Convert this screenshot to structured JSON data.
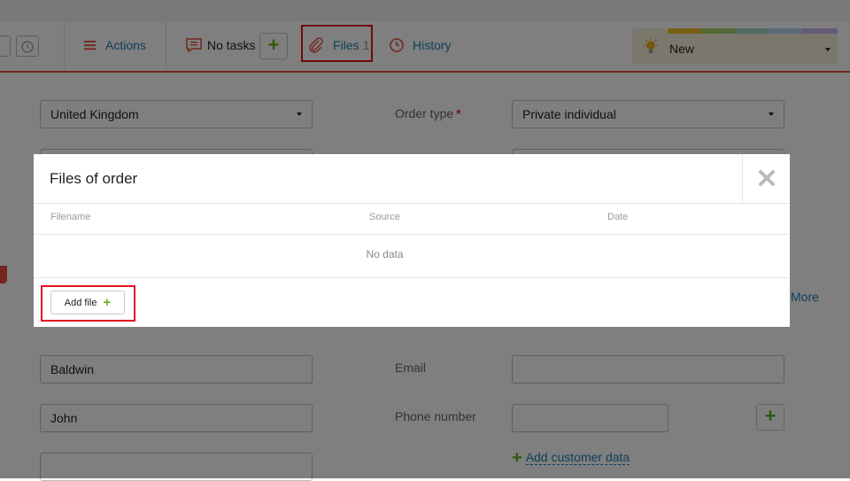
{
  "toolbar": {
    "actions_label": "Actions",
    "tasks_label": "No tasks",
    "files_label": "Files",
    "files_count": "1",
    "history_label": "History",
    "add_task_label": "+"
  },
  "status": {
    "selected": "New",
    "strip_colors": [
      "#f5c02e",
      "#a6d36d",
      "#62cfa5",
      "#9fd9e3",
      "#b9d6f0",
      "#c4b4e8",
      "#f0a4c8"
    ]
  },
  "form": {
    "country_value": "United Kingdom",
    "order_type_label": "Order type",
    "order_type_required": "*",
    "order_type_value": "Private individual",
    "last_name_value": "Baldwin",
    "first_name_value": "John",
    "email_label": "Email",
    "phone_label": "Phone number",
    "add_phone_label": "+",
    "add_customer_data": "Add customer data",
    "more_label": "More"
  },
  "modal": {
    "title": "Files of order",
    "columns": [
      "Filename",
      "Source",
      "Date"
    ],
    "empty_text": "No data",
    "add_file_label": "Add file"
  },
  "colors": {
    "accent_red": "#e84b3a",
    "link_blue": "#1a7fb0",
    "plus_green": "#5fb61b",
    "highlight": "#e0141c"
  }
}
